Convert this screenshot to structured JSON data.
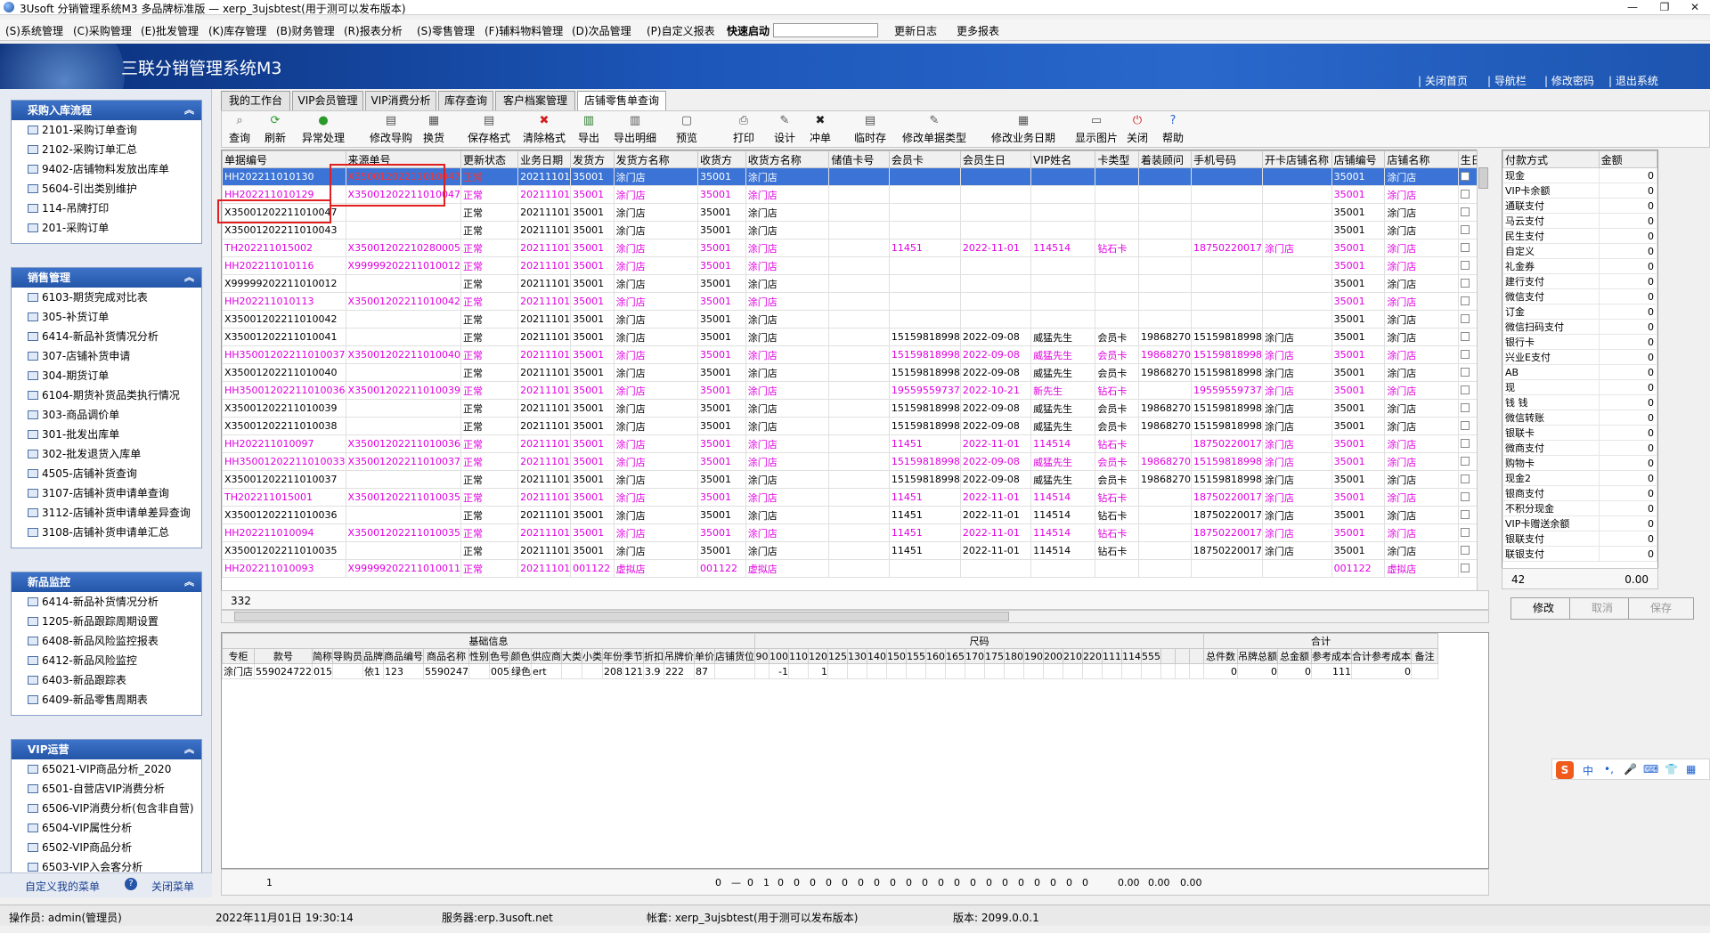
{
  "window": {
    "title": "3Usoft 分销管理系统M3 多品牌标准版 — xerp_3ujsbtest(用于测可以发布版本)",
    "btn_min": "—",
    "btn_max": "❐",
    "btn_close": "✕"
  },
  "menu": [
    "(S)系统管理",
    "(C)采购管理",
    "(E)批发管理",
    "(K)库存管理",
    "(B)财务管理",
    "(R)报表分析",
    "(S)零售管理",
    "(F)辅料物料管理",
    "(D)次品管理",
    "(P)自定义报表",
    "快速启动",
    "更新日志",
    "更多报表"
  ],
  "banner": {
    "title": "三联分销管理系统M3",
    "links": [
      "| 关闭首页",
      "| 导航栏",
      "| 修改密码",
      "| 退出系统"
    ]
  },
  "sidebar": {
    "panels": [
      {
        "title": "采购入库流程",
        "items": [
          "2101-采购订单查询",
          "2102-采购订单汇总",
          "9402-店铺物料发放出库单",
          "5604-引出类别维护",
          "114-吊牌打印",
          "201-采购订单"
        ]
      },
      {
        "title": "销售管理",
        "items": [
          "6103-期货完成对比表",
          "305-补货订单",
          "6414-新品补货情况分析",
          "307-店铺补货申请",
          "304-期货订单",
          "6104-期货补货品类执行情况",
          "303-商品调价单",
          "301-批发出库单",
          "302-批发退货入库单",
          "4505-店铺补货查询",
          "3107-店铺补货申请单查询",
          "3112-店铺补货申请单差异查询",
          "3108-店铺补货申请单汇总"
        ]
      },
      {
        "title": "新品监控",
        "items": [
          "6414-新品补货情况分析",
          "1205-新品跟踪周期设置",
          "6408-新品风险监控报表",
          "6412-新品风险监控",
          "6403-新品跟踪表",
          "6409-新品零售周期表"
        ]
      },
      {
        "title": "VIP运营",
        "items": [
          "65021-VIP商品分析_2020",
          "6501-自营店VIP消费分析",
          "6506-VIP消费分析(包含非自营)",
          "6504-VIP属性分析",
          "6502-VIP商品分析",
          "6503-VIP入会客分析"
        ]
      }
    ],
    "bottom": {
      "custom": "自定义我的菜单",
      "close": "关闭菜单",
      "help_icon": "?"
    }
  },
  "tabs": [
    "我的工作台",
    "VIP会员管理",
    "VIP消费分析",
    "库存查询",
    "客户档案管理",
    "店铺零售单查询"
  ],
  "toolbar": [
    {
      "label": "查询",
      "icon": "search-icon",
      "glyph": "⌕",
      "color": "#666"
    },
    {
      "label": "刷新",
      "icon": "refresh-icon",
      "glyph": "⟳",
      "color": "#2a9a2a"
    },
    {
      "label": "异常处理",
      "icon": "exception-icon",
      "glyph": "●",
      "color": "#2a9a2a"
    },
    {
      "label": "修改导购",
      "icon": "edit-guide-icon",
      "glyph": "▤",
      "color": "#555"
    },
    {
      "label": "换货",
      "icon": "exchange-icon",
      "glyph": "▦",
      "color": "#555"
    },
    {
      "label": "保存格式",
      "icon": "save-format-icon",
      "glyph": "▤",
      "color": "#555"
    },
    {
      "label": "清除格式",
      "icon": "clear-format-icon",
      "glyph": "✖",
      "color": "#d02020"
    },
    {
      "label": "导出",
      "icon": "export-icon",
      "glyph": "▥",
      "color": "#2a7a2a"
    },
    {
      "label": "导出明细",
      "icon": "export-detail-icon",
      "glyph": "▥",
      "color": "#555"
    },
    {
      "label": "预览",
      "icon": "preview-icon",
      "glyph": "▢",
      "color": "#555"
    },
    {
      "label": "打印",
      "icon": "print-icon",
      "glyph": "⎙",
      "color": "#555"
    },
    {
      "label": "设计",
      "icon": "design-icon",
      "glyph": "✎",
      "color": "#555"
    },
    {
      "label": "冲单",
      "icon": "cancel-order-icon",
      "glyph": "✖",
      "color": "#222"
    },
    {
      "label": "临时存",
      "icon": "temp-save-icon",
      "glyph": "▤",
      "color": "#555"
    },
    {
      "label": "修改单据类型",
      "icon": "edit-type-icon",
      "glyph": "✎",
      "color": "#555"
    },
    {
      "label": "修改业务日期",
      "icon": "edit-date-icon",
      "glyph": "▦",
      "color": "#555"
    },
    {
      "label": "显示图片",
      "icon": "image-icon",
      "glyph": "▭",
      "color": "#555"
    },
    {
      "label": "关闭",
      "icon": "close-icon",
      "glyph": "⏻",
      "color": "#d02020"
    },
    {
      "label": "帮助",
      "icon": "help-icon",
      "glyph": "?",
      "color": "#2a6ad0"
    }
  ],
  "grid": {
    "headers": [
      "单据编号",
      "来源单号",
      "更新状态",
      "业务日期",
      "发货方",
      "发货方名称",
      "收货方",
      "收货方名称",
      "储值卡号",
      "会员卡",
      "会员生日",
      "VIP姓名",
      "卡类型",
      "着装顾问",
      "手机号码",
      "开卡店铺名称",
      "店铺编号",
      "店铺名称",
      "生日"
    ],
    "rows": [
      {
        "c": [
          "HH202211010130",
          "X35001202211010047",
          "正常",
          "20211101",
          "35001",
          "涂门店",
          "35001",
          "涂门店",
          "",
          "",
          "",
          "",
          "",
          "",
          "",
          "",
          "35001",
          "涂门店"
        ],
        "s": "sel"
      },
      {
        "c": [
          "HH202211010129",
          "X35001202211010047",
          "正常",
          "20211101",
          "35001",
          "涂门店",
          "35001",
          "涂门店",
          "",
          "",
          "",
          "",
          "",
          "",
          "",
          "",
          "35001",
          "涂门店"
        ],
        "s": "mag"
      },
      {
        "c": [
          "X35001202211010047",
          "",
          "正常",
          "20211101",
          "35001",
          "涂门店",
          "35001",
          "涂门店",
          "",
          "",
          "",
          "",
          "",
          "",
          "",
          "",
          "35001",
          "涂门店"
        ],
        "s": ""
      },
      {
        "c": [
          "X35001202211010043",
          "",
          "正常",
          "20211101",
          "35001",
          "涂门店",
          "35001",
          "涂门店",
          "",
          "",
          "",
          "",
          "",
          "",
          "",
          "",
          "35001",
          "涂门店"
        ],
        "s": ""
      },
      {
        "c": [
          "TH202211015002",
          "X35001202210280005",
          "正常",
          "20211101",
          "35001",
          "涂门店",
          "35001",
          "涂门店",
          "",
          "11451",
          "2022-11-01",
          "114514",
          "钻石卡",
          "",
          "18750220017",
          "涂门店",
          "35001",
          "涂门店"
        ],
        "s": "mag"
      },
      {
        "c": [
          "HH202211010116",
          "X99999202211010012",
          "正常",
          "20211101",
          "35001",
          "涂门店",
          "35001",
          "涂门店",
          "",
          "",
          "",
          "",
          "",
          "",
          "",
          "",
          "35001",
          "涂门店"
        ],
        "s": "mag"
      },
      {
        "c": [
          "X99999202211010012",
          "",
          "正常",
          "20211101",
          "35001",
          "涂门店",
          "35001",
          "涂门店",
          "",
          "",
          "",
          "",
          "",
          "",
          "",
          "",
          "35001",
          "涂门店"
        ],
        "s": ""
      },
      {
        "c": [
          "HH202211010113",
          "X35001202211010042",
          "正常",
          "20211101",
          "35001",
          "涂门店",
          "35001",
          "涂门店",
          "",
          "",
          "",
          "",
          "",
          "",
          "",
          "",
          "35001",
          "涂门店"
        ],
        "s": "mag"
      },
      {
        "c": [
          "X35001202211010042",
          "",
          "正常",
          "20211101",
          "35001",
          "涂门店",
          "35001",
          "涂门店",
          "",
          "",
          "",
          "",
          "",
          "",
          "",
          "",
          "35001",
          "涂门店"
        ],
        "s": ""
      },
      {
        "c": [
          "X35001202211010041",
          "",
          "正常",
          "20211101",
          "35001",
          "涂门店",
          "35001",
          "涂门店",
          "",
          "15159818998",
          "2022-09-08",
          "威猛先生",
          "会员卡",
          "19868270",
          "15159818998",
          "涂门店",
          "35001",
          "涂门店"
        ],
        "s": ""
      },
      {
        "c": [
          "HH35001202211010037",
          "X35001202211010040",
          "正常",
          "20211101",
          "35001",
          "涂门店",
          "35001",
          "涂门店",
          "",
          "15159818998",
          "2022-09-08",
          "威猛先生",
          "会员卡",
          "19868270",
          "15159818998",
          "涂门店",
          "35001",
          "涂门店"
        ],
        "s": "mag"
      },
      {
        "c": [
          "X35001202211010040",
          "",
          "正常",
          "20211101",
          "35001",
          "涂门店",
          "35001",
          "涂门店",
          "",
          "15159818998",
          "2022-09-08",
          "威猛先生",
          "会员卡",
          "19868270",
          "15159818998",
          "涂门店",
          "35001",
          "涂门店"
        ],
        "s": ""
      },
      {
        "c": [
          "HH35001202211010036",
          "X35001202211010039",
          "正常",
          "20211101",
          "35001",
          "涂门店",
          "35001",
          "涂门店",
          "",
          "19559559737",
          "2022-10-21",
          "新先生",
          "钻石卡",
          "",
          "19559559737",
          "涂门店",
          "35001",
          "涂门店"
        ],
        "s": "mag"
      },
      {
        "c": [
          "X35001202211010039",
          "",
          "正常",
          "20211101",
          "35001",
          "涂门店",
          "35001",
          "涂门店",
          "",
          "15159818998",
          "2022-09-08",
          "威猛先生",
          "会员卡",
          "19868270",
          "15159818998",
          "涂门店",
          "35001",
          "涂门店"
        ],
        "s": ""
      },
      {
        "c": [
          "X35001202211010038",
          "",
          "正常",
          "20211101",
          "35001",
          "涂门店",
          "35001",
          "涂门店",
          "",
          "15159818998",
          "2022-09-08",
          "威猛先生",
          "会员卡",
          "19868270",
          "15159818998",
          "涂门店",
          "35001",
          "涂门店"
        ],
        "s": ""
      },
      {
        "c": [
          "HH202211010097",
          "X35001202211010036",
          "正常",
          "20211101",
          "35001",
          "涂门店",
          "35001",
          "涂门店",
          "",
          "11451",
          "2022-11-01",
          "114514",
          "钻石卡",
          "",
          "18750220017",
          "涂门店",
          "35001",
          "涂门店"
        ],
        "s": "mag"
      },
      {
        "c": [
          "HH35001202211010033",
          "X35001202211010037",
          "正常",
          "20211101",
          "35001",
          "涂门店",
          "35001",
          "涂门店",
          "",
          "15159818998",
          "2022-09-08",
          "威猛先生",
          "会员卡",
          "19868270",
          "15159818998",
          "涂门店",
          "35001",
          "涂门店"
        ],
        "s": "mag"
      },
      {
        "c": [
          "X35001202211010037",
          "",
          "正常",
          "20211101",
          "35001",
          "涂门店",
          "35001",
          "涂门店",
          "",
          "15159818998",
          "2022-09-08",
          "威猛先生",
          "会员卡",
          "19868270",
          "15159818998",
          "涂门店",
          "35001",
          "涂门店"
        ],
        "s": ""
      },
      {
        "c": [
          "TH202211015001",
          "X35001202211010035",
          "正常",
          "20211101",
          "35001",
          "涂门店",
          "35001",
          "涂门店",
          "",
          "11451",
          "2022-11-01",
          "114514",
          "钻石卡",
          "",
          "18750220017",
          "涂门店",
          "35001",
          "涂门店"
        ],
        "s": "mag"
      },
      {
        "c": [
          "X35001202211010036",
          "",
          "正常",
          "20211101",
          "35001",
          "涂门店",
          "35001",
          "涂门店",
          "",
          "11451",
          "2022-11-01",
          "114514",
          "钻石卡",
          "",
          "18750220017",
          "涂门店",
          "35001",
          "涂门店"
        ],
        "s": ""
      },
      {
        "c": [
          "HH202211010094",
          "X35001202211010035",
          "正常",
          "20211101",
          "35001",
          "涂门店",
          "35001",
          "涂门店",
          "",
          "11451",
          "2022-11-01",
          "114514",
          "钻石卡",
          "",
          "18750220017",
          "涂门店",
          "35001",
          "涂门店"
        ],
        "s": "mag"
      },
      {
        "c": [
          "X35001202211010035",
          "",
          "正常",
          "20211101",
          "35001",
          "涂门店",
          "35001",
          "涂门店",
          "",
          "11451",
          "2022-11-01",
          "114514",
          "钻石卡",
          "",
          "18750220017",
          "涂门店",
          "35001",
          "涂门店"
        ],
        "s": ""
      },
      {
        "c": [
          "HH202211010093",
          "X99999202211010011",
          "正常",
          "20211101",
          "001122",
          "虚拟店",
          "001122",
          "虚拟店",
          "",
          "",
          "",
          "",
          "",
          "",
          "",
          "",
          "001122",
          "虚拟店"
        ],
        "s": "mag"
      }
    ],
    "row_count": "332"
  },
  "payment": {
    "headers": [
      "付款方式",
      "金额"
    ],
    "rows": [
      [
        "现金",
        "0"
      ],
      [
        "VIP卡余额",
        "0"
      ],
      [
        "通联支付",
        "0"
      ],
      [
        "马云支付",
        "0"
      ],
      [
        "民生支付",
        "0"
      ],
      [
        "自定义",
        "0"
      ],
      [
        "礼金券",
        "0"
      ],
      [
        "建行支付",
        "0"
      ],
      [
        "微信支付",
        "0"
      ],
      [
        "订金",
        "0"
      ],
      [
        "微信扫码支付",
        "0"
      ],
      [
        "银行卡",
        "0"
      ],
      [
        "兴业E支付",
        "0"
      ],
      [
        "AB",
        "0"
      ],
      [
        "现",
        "0"
      ],
      [
        "钱 钱",
        "0"
      ],
      [
        "微信转账",
        "0"
      ],
      [
        "银联卡",
        "0"
      ],
      [
        "微商支付",
        "0"
      ],
      [
        "购物卡",
        "0"
      ],
      [
        "现金2",
        "0"
      ],
      [
        "银商支付",
        "0"
      ],
      [
        "不积分现金",
        "0"
      ],
      [
        "VIP卡赠送余额",
        "0"
      ],
      [
        "银联支付",
        "0"
      ],
      [
        "联银支付",
        "0"
      ]
    ],
    "count": "42",
    "total": "0.00",
    "buttons": [
      "修改",
      "取消",
      "保存"
    ]
  },
  "lower": {
    "groups": [
      "基础信息",
      "尺码",
      "合计"
    ],
    "headers": [
      "专柜",
      "款号",
      "简称",
      "导购员",
      "品牌",
      "商品编号",
      "商品名称",
      "性别",
      "色号",
      "颜色",
      "供应商",
      "大类",
      "小类",
      "年份",
      "季节",
      "折扣",
      "吊牌价",
      "单价",
      "店铺货位",
      "90",
      "100",
      "110",
      "120",
      "125",
      "130",
      "140",
      "150",
      "155",
      "160",
      "165",
      "170",
      "175",
      "180",
      "190",
      "200",
      "210",
      "220",
      "111",
      "114",
      "555",
      "",
      "",
      "",
      "总件数",
      "吊牌总额",
      "总金额",
      "参考成本",
      "合计参考成本",
      "备注"
    ],
    "row": [
      "涂门店",
      "559024722",
      "015",
      "",
      "依1",
      "123",
      "5590247",
      "",
      "005",
      "绿色",
      "ert",
      "",
      "",
      "208",
      "121",
      "3.9",
      "222",
      "87",
      "",
      "",
      "-1",
      "",
      "1",
      "",
      "",
      "",
      "",
      "",
      "",
      "",
      "",
      "",
      "",
      "",
      "",
      "",
      "",
      "",
      "",
      "",
      "",
      "",
      "",
      "0",
      "0",
      "0",
      "111",
      "0",
      ""
    ],
    "footer": [
      "1",
      "0",
      "—",
      "0",
      "1",
      "0",
      "0",
      "0",
      "0",
      "0",
      "0",
      "0",
      "0",
      "0",
      "0",
      "0",
      "0",
      "0",
      "0",
      "0",
      "0",
      "0",
      "0",
      "0",
      "0",
      "0.00",
      "0.00",
      "0.00"
    ]
  },
  "status": {
    "operator": "操作员: admin(管理员)",
    "datetime": "2022年11月01日 19:30:14",
    "server": "服务器:erp.3usoft.net",
    "account": "帐套: xerp_3ujsbtest(用于测可以发布版本)",
    "version": "版本: 2099.0.0.1"
  },
  "ime": {
    "logo": "S",
    "items": [
      "中",
      "•,",
      "🎤",
      "⌨",
      "👕",
      "▦"
    ]
  }
}
